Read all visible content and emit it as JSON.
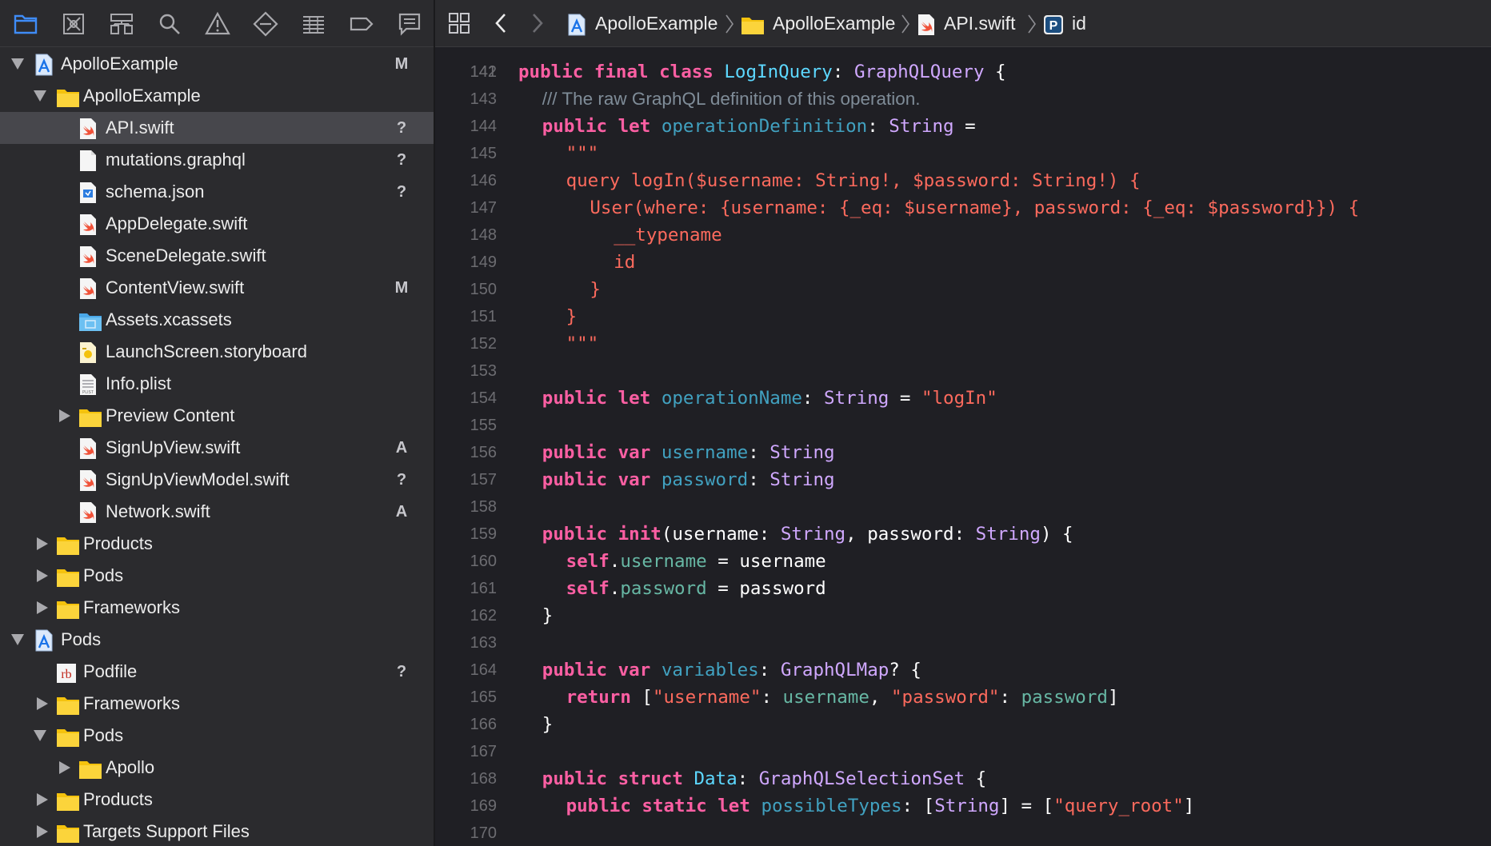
{
  "navigator": {
    "tabs": [
      "project-navigator",
      "source-control",
      "symbol-navigator",
      "find",
      "issues",
      "tests",
      "debug",
      "breakpoints",
      "reports"
    ],
    "tree": [
      {
        "name": "ApolloExample",
        "depth": 0,
        "disc": "open",
        "icon": "project",
        "badge": "M"
      },
      {
        "name": "ApolloExample",
        "depth": 1,
        "disc": "open",
        "icon": "folder",
        "badge": ""
      },
      {
        "name": "API.swift",
        "depth": 2,
        "disc": "",
        "icon": "swift",
        "badge": "?",
        "selected": true
      },
      {
        "name": "mutations.graphql",
        "depth": 2,
        "disc": "",
        "icon": "file",
        "badge": "?"
      },
      {
        "name": "schema.json",
        "depth": 2,
        "disc": "",
        "icon": "json",
        "badge": "?"
      },
      {
        "name": "AppDelegate.swift",
        "depth": 2,
        "disc": "",
        "icon": "swift",
        "badge": ""
      },
      {
        "name": "SceneDelegate.swift",
        "depth": 2,
        "disc": "",
        "icon": "swift",
        "badge": ""
      },
      {
        "name": "ContentView.swift",
        "depth": 2,
        "disc": "",
        "icon": "swift",
        "badge": "M"
      },
      {
        "name": "Assets.xcassets",
        "depth": 2,
        "disc": "",
        "icon": "assets",
        "badge": ""
      },
      {
        "name": "LaunchScreen.storyboard",
        "depth": 2,
        "disc": "",
        "icon": "storyboard",
        "badge": ""
      },
      {
        "name": "Info.plist",
        "depth": 2,
        "disc": "",
        "icon": "plist",
        "badge": ""
      },
      {
        "name": "Preview Content",
        "depth": 2,
        "disc": "closed",
        "icon": "folder",
        "badge": ""
      },
      {
        "name": "SignUpView.swift",
        "depth": 2,
        "disc": "",
        "icon": "swift",
        "badge": "A"
      },
      {
        "name": "SignUpViewModel.swift",
        "depth": 2,
        "disc": "",
        "icon": "swift",
        "badge": "?"
      },
      {
        "name": "Network.swift",
        "depth": 2,
        "disc": "",
        "icon": "swift",
        "badge": "A"
      },
      {
        "name": "Products",
        "depth": 1,
        "disc": "closed",
        "icon": "folder",
        "badge": ""
      },
      {
        "name": "Pods",
        "depth": 1,
        "disc": "closed",
        "icon": "folder",
        "badge": ""
      },
      {
        "name": "Frameworks",
        "depth": 1,
        "disc": "closed",
        "icon": "folder",
        "badge": ""
      },
      {
        "name": "Pods",
        "depth": 0,
        "disc": "open",
        "icon": "project",
        "badge": ""
      },
      {
        "name": "Podfile",
        "depth": 1,
        "disc": "",
        "icon": "ruby",
        "badge": "?"
      },
      {
        "name": "Frameworks",
        "depth": 1,
        "disc": "closed",
        "icon": "folder",
        "badge": ""
      },
      {
        "name": "Pods",
        "depth": 1,
        "disc": "open",
        "icon": "folder",
        "badge": ""
      },
      {
        "name": "Apollo",
        "depth": 2,
        "disc": "closed",
        "icon": "folder",
        "badge": ""
      },
      {
        "name": "Products",
        "depth": 1,
        "disc": "closed",
        "icon": "folder",
        "badge": ""
      },
      {
        "name": "Targets Support Files",
        "depth": 1,
        "disc": "closed",
        "icon": "folder",
        "badge": ""
      }
    ]
  },
  "jumpbar": {
    "crumbs": [
      "ApolloExample",
      "ApolloExample",
      "API.swift",
      "id"
    ]
  },
  "editor": {
    "first_partial_line": "141",
    "lines": [
      {
        "n": "142",
        "indent": 0,
        "t": [
          [
            "kw",
            "public final class "
          ],
          [
            "tyd",
            "LogInQuery"
          ],
          [
            "pln",
            ": "
          ],
          [
            "ty",
            "GraphQLQuery"
          ],
          [
            "pln",
            " {"
          ]
        ]
      },
      {
        "n": "143",
        "indent": 1,
        "t": [
          [
            "com",
            "/// The raw GraphQL definition of this operation."
          ]
        ]
      },
      {
        "n": "144",
        "indent": 1,
        "t": [
          [
            "kw",
            "public let "
          ],
          [
            "idn",
            "operationDefinition"
          ],
          [
            "pln",
            ": "
          ],
          [
            "ty",
            "String"
          ],
          [
            "pln",
            " ="
          ]
        ]
      },
      {
        "n": "145",
        "indent": 2,
        "t": [
          [
            "str",
            "\"\"\""
          ]
        ]
      },
      {
        "n": "146",
        "indent": 2,
        "t": [
          [
            "str",
            "query logIn($username: String!, $password: String!) {"
          ]
        ]
      },
      {
        "n": "147",
        "indent": 3,
        "t": [
          [
            "str",
            "User(where: {username: {_eq: $username}, password: {_eq: $password}}) {"
          ]
        ]
      },
      {
        "n": "148",
        "indent": 4,
        "t": [
          [
            "str",
            "__typename"
          ]
        ]
      },
      {
        "n": "149",
        "indent": 4,
        "t": [
          [
            "str",
            "id"
          ]
        ]
      },
      {
        "n": "150",
        "indent": 3,
        "t": [
          [
            "str",
            "}"
          ]
        ]
      },
      {
        "n": "151",
        "indent": 2,
        "t": [
          [
            "str",
            "}"
          ]
        ]
      },
      {
        "n": "152",
        "indent": 2,
        "t": [
          [
            "str",
            "\"\"\""
          ]
        ]
      },
      {
        "n": "153",
        "indent": 0,
        "t": []
      },
      {
        "n": "154",
        "indent": 1,
        "t": [
          [
            "kw",
            "public let "
          ],
          [
            "idn",
            "operationName"
          ],
          [
            "pln",
            ": "
          ],
          [
            "ty",
            "String"
          ],
          [
            "pln",
            " = "
          ],
          [
            "str",
            "\"logIn\""
          ]
        ]
      },
      {
        "n": "155",
        "indent": 0,
        "t": []
      },
      {
        "n": "156",
        "indent": 1,
        "t": [
          [
            "kw",
            "public var "
          ],
          [
            "idn",
            "username"
          ],
          [
            "pln",
            ": "
          ],
          [
            "ty",
            "String"
          ]
        ]
      },
      {
        "n": "157",
        "indent": 1,
        "t": [
          [
            "kw",
            "public var "
          ],
          [
            "idn",
            "password"
          ],
          [
            "pln",
            ": "
          ],
          [
            "ty",
            "String"
          ]
        ]
      },
      {
        "n": "158",
        "indent": 0,
        "t": []
      },
      {
        "n": "159",
        "indent": 1,
        "t": [
          [
            "kw",
            "public init"
          ],
          [
            "pln",
            "(username: "
          ],
          [
            "ty",
            "String"
          ],
          [
            "pln",
            ", password: "
          ],
          [
            "ty",
            "String"
          ],
          [
            "pln",
            ") {"
          ]
        ]
      },
      {
        "n": "160",
        "indent": 2,
        "t": [
          [
            "kw",
            "self"
          ],
          [
            "pln",
            "."
          ],
          [
            "prp",
            "username"
          ],
          [
            "pln",
            " = username"
          ]
        ]
      },
      {
        "n": "161",
        "indent": 2,
        "t": [
          [
            "kw",
            "self"
          ],
          [
            "pln",
            "."
          ],
          [
            "prp",
            "password"
          ],
          [
            "pln",
            " = password"
          ]
        ]
      },
      {
        "n": "162",
        "indent": 1,
        "t": [
          [
            "pln",
            "}"
          ]
        ]
      },
      {
        "n": "163",
        "indent": 0,
        "t": []
      },
      {
        "n": "164",
        "indent": 1,
        "t": [
          [
            "kw",
            "public var "
          ],
          [
            "idn",
            "variables"
          ],
          [
            "pln",
            ": "
          ],
          [
            "ty",
            "GraphQLMap"
          ],
          [
            "pln",
            "? {"
          ]
        ]
      },
      {
        "n": "165",
        "indent": 2,
        "t": [
          [
            "kw",
            "return "
          ],
          [
            "pln",
            "["
          ],
          [
            "str",
            "\"username\""
          ],
          [
            "pln",
            ": "
          ],
          [
            "prp",
            "username"
          ],
          [
            "pln",
            ", "
          ],
          [
            "str",
            "\"password\""
          ],
          [
            "pln",
            ": "
          ],
          [
            "prp",
            "password"
          ],
          [
            "pln",
            "]"
          ]
        ]
      },
      {
        "n": "166",
        "indent": 1,
        "t": [
          [
            "pln",
            "}"
          ]
        ]
      },
      {
        "n": "167",
        "indent": 0,
        "t": []
      },
      {
        "n": "168",
        "indent": 1,
        "t": [
          [
            "kw",
            "public struct "
          ],
          [
            "tyd",
            "Data"
          ],
          [
            "pln",
            ": "
          ],
          [
            "ty",
            "GraphQLSelectionSet"
          ],
          [
            "pln",
            " {"
          ]
        ]
      },
      {
        "n": "169",
        "indent": 2,
        "t": [
          [
            "kw",
            "public static let "
          ],
          [
            "idn",
            "possibleTypes"
          ],
          [
            "pln",
            ": ["
          ],
          [
            "ty",
            "String"
          ],
          [
            "pln",
            "] = ["
          ],
          [
            "str",
            "\"query_root\""
          ],
          [
            "pln",
            "]"
          ]
        ]
      },
      {
        "n": "170",
        "indent": 0,
        "t": []
      }
    ]
  },
  "colors": {
    "keyword": "#fc5fa3",
    "type": "#d0a8ff",
    "type_decl": "#5dd8ff",
    "identifier": "#41a1c0",
    "string": "#fc6a5d",
    "comment": "#7f8c98",
    "property": "#67b7a4"
  }
}
